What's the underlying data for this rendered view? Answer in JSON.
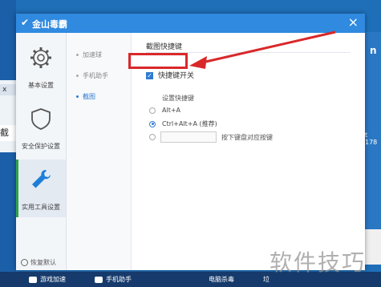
{
  "background": {
    "left_tab": "x",
    "left_char": "截",
    "right_letter": "n",
    "right_number": "t 178"
  },
  "window": {
    "title": "金山毒霸",
    "close_glyph": "×"
  },
  "sidebar": {
    "items": [
      {
        "label": "基本设置",
        "icon": "gear-icon"
      },
      {
        "label": "安全保护设置",
        "icon": "shield-icon"
      },
      {
        "label": "实用工具设置",
        "icon": "wrench-icon"
      }
    ],
    "restore_label": "恢复默认"
  },
  "subnav": {
    "items": [
      {
        "label": "加速球"
      },
      {
        "label": "手机助手"
      },
      {
        "label": "截图"
      }
    ]
  },
  "content": {
    "section_title": "截图快捷键",
    "checkbox_label": "快捷键开关",
    "checkbox_checked": true,
    "sub_label": "设置快捷键",
    "radios": [
      {
        "label": "Alt+A",
        "checked": false
      },
      {
        "label": "Ctrl+Alt+A (推荐)",
        "checked": true
      }
    ],
    "custom_hint": "按下键盘对应按键",
    "custom_value": ""
  },
  "taskbar": {
    "items": [
      {
        "label": "游戏加速"
      },
      {
        "label": "手机助手"
      },
      {
        "label": "电脑杀毒"
      },
      {
        "label": "垃"
      }
    ]
  },
  "watermark": "软件技巧",
  "colors": {
    "accent": "#2f7bd2",
    "titlebar": "#2f8ae0",
    "highlight": "#d9282a",
    "active_indicator": "#2ea34a"
  }
}
